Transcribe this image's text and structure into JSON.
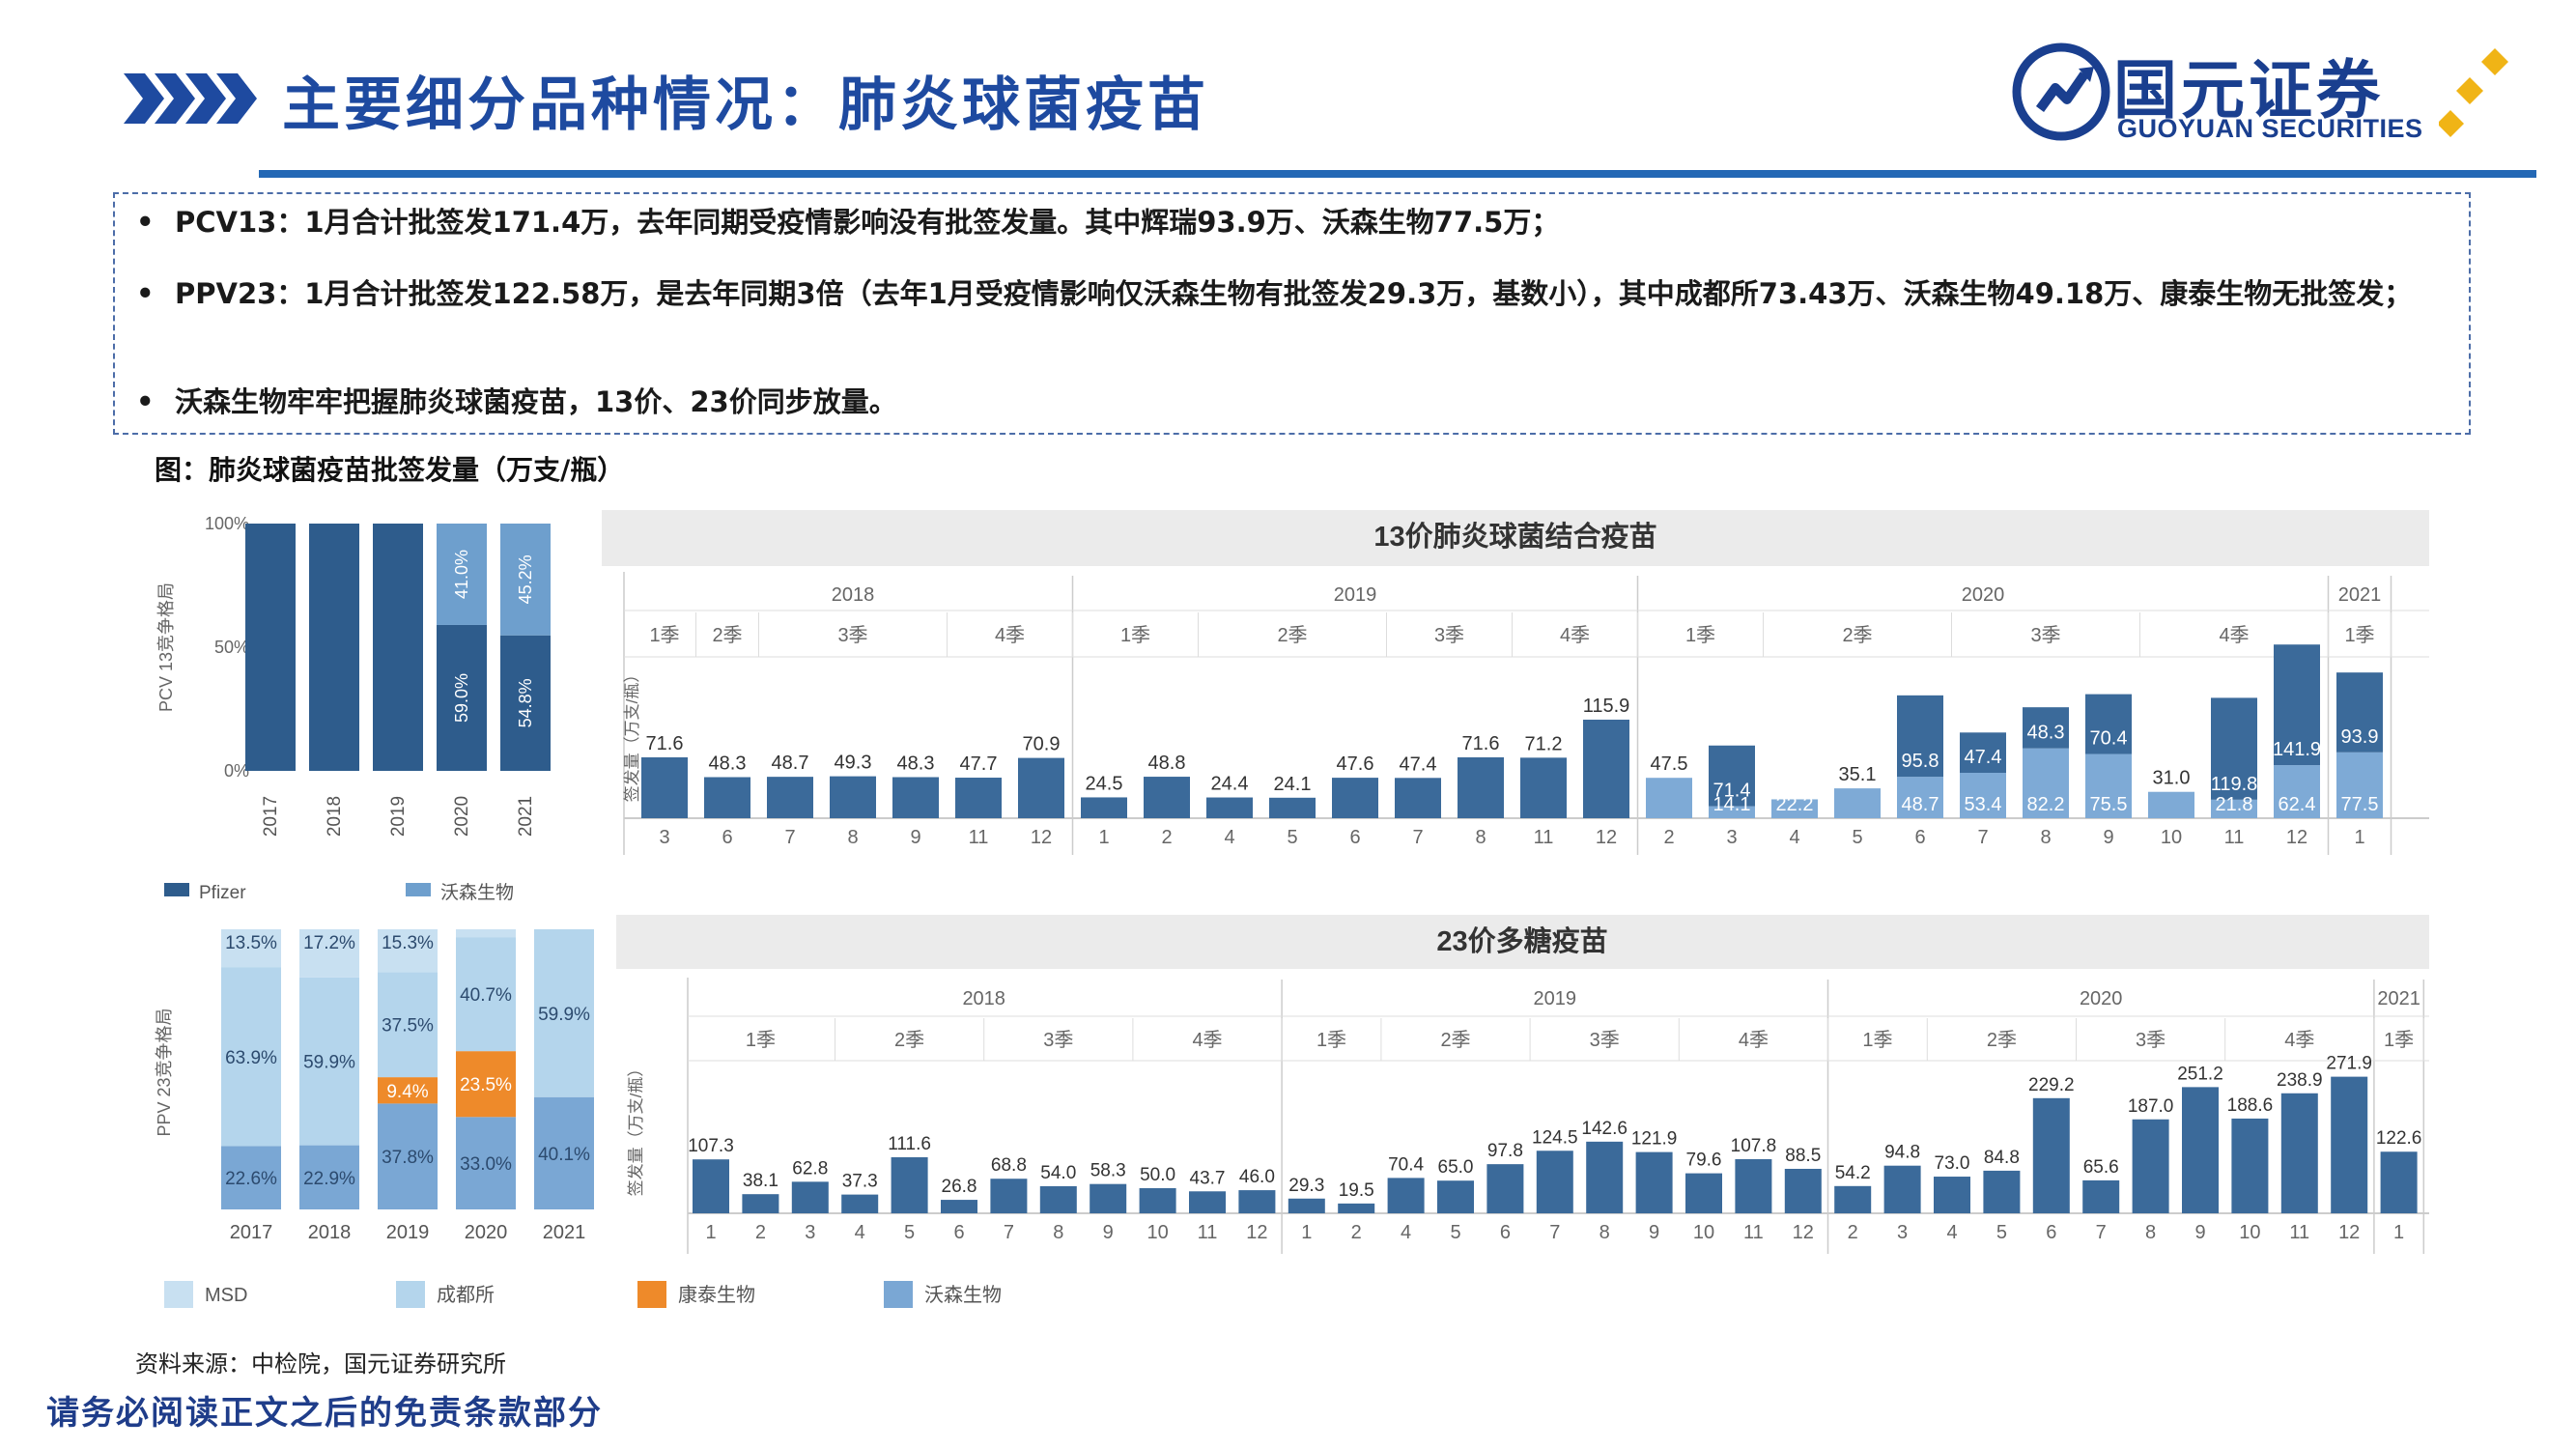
{
  "header": {
    "title": "主要细分品种情况：肺炎球菌疫苗",
    "logo_cn": "国元证券",
    "logo_en": "GUOYUAN SECURITIES",
    "accent": "#1e4aa0",
    "gold": "#f0b416"
  },
  "bullets": [
    "PCV13：1月合计批签发171.4万，去年同期受疫情影响没有批签发量。其中辉瑞93.9万、沃森生物77.5万；",
    "PPV23：1月合计批签发122.58万，是去年同期3倍（去年1月受疫情影响仅沃森生物有批签发29.3万，基数小），其中成都所73.43万、沃森生物49.18万、康泰生物无批签发；",
    "沃森生物牢牢把握肺炎球菌疫苗，13价、23价同步放量。"
  ],
  "figure_caption": "图：肺炎球菌疫苗批签发量（万支/瓶）",
  "source": "资料来源：中检院，国元证券研究所",
  "disclaimer": "请务必阅读正文之后的免责条款部分",
  "chart_data": [
    {
      "type": "bar",
      "stacked": true,
      "ylabel": "PCV 13竞争格局",
      "categories": [
        "2017",
        "2018",
        "2019",
        "2020",
        "2021"
      ],
      "ylim": [
        0,
        100
      ],
      "yticks": [
        "0%",
        "50%",
        "100%"
      ],
      "series": [
        {
          "name": "Pfizer",
          "color": "#2e5c8c",
          "values": [
            100,
            100,
            100,
            59.0,
            54.8
          ],
          "labels": [
            "",
            "",
            "",
            "59.0%",
            "54.8%"
          ]
        },
        {
          "name": "沃森生物",
          "color": "#6e9fcd",
          "values": [
            0,
            0,
            0,
            41.0,
            45.2
          ],
          "labels": [
            "",
            "",
            "",
            "41.0%",
            "45.2%"
          ]
        }
      ]
    },
    {
      "type": "bar",
      "stacked": true,
      "title": "13价肺炎球菌结合疫苗",
      "ylabel": "签发量（万支/瓶）",
      "years": [
        "2018",
        "2019",
        "2020",
        "2021"
      ],
      "quarters": [
        "1季",
        "2季",
        "3季",
        "4季",
        "1季",
        "2季",
        "3季",
        "4季",
        "1季",
        "2季",
        "3季",
        "4季",
        "1季"
      ],
      "categories": [
        "3",
        "6",
        "7",
        "8",
        "9",
        "11",
        "12",
        "1",
        "2",
        "4",
        "5",
        "6",
        "7",
        "8",
        "11",
        "12",
        "2",
        "3",
        "4",
        "5",
        "6",
        "7",
        "8",
        "9",
        "10",
        "11",
        "12",
        "1"
      ],
      "series": [
        {
          "name": "辉瑞",
          "color": "#3b6a9a",
          "values": [
            71.6,
            48.3,
            48.7,
            49.3,
            48.3,
            47.7,
            70.9,
            24.5,
            48.8,
            24.4,
            24.1,
            47.6,
            47.4,
            71.6,
            71.2,
            115.9,
            0,
            71.4,
            0,
            0,
            95.8,
            47.4,
            48.3,
            70.4,
            0,
            119.8,
            141.9,
            93.9
          ]
        },
        {
          "name": "沃森生物",
          "color": "#7eaad6",
          "values": [
            0,
            0,
            0,
            0,
            0,
            0,
            0,
            0,
            0,
            0,
            0,
            0,
            0,
            0,
            0,
            0,
            47.5,
            14.1,
            22.2,
            35.1,
            48.7,
            53.4,
            82.2,
            75.5,
            31.0,
            21.8,
            62.4,
            77.5
          ]
        }
      ]
    },
    {
      "type": "bar",
      "stacked": true,
      "ylabel": "PPV 23竞争格局",
      "categories": [
        "2017",
        "2018",
        "2019",
        "2020",
        "2021"
      ],
      "ylim": [
        0,
        100
      ],
      "series": [
        {
          "name": "沃森生物",
          "color": "#7aa7d4",
          "values": [
            22.6,
            22.9,
            37.8,
            33.0,
            40.1
          ],
          "labels": [
            "22.6%",
            "22.9%",
            "37.8%",
            "33.0%",
            "40.1%"
          ]
        },
        {
          "name": "康泰生物",
          "color": "#ee8a2a",
          "values": [
            0,
            0,
            9.4,
            23.5,
            0
          ],
          "labels": [
            "",
            "",
            "9.4%",
            "23.5%",
            ""
          ]
        },
        {
          "name": "成都所",
          "color": "#b4d5ec",
          "values": [
            63.9,
            59.9,
            37.5,
            40.7,
            59.9
          ],
          "labels": [
            "63.9%",
            "59.9%",
            "37.5%",
            "40.7%",
            "59.9%"
          ]
        },
        {
          "name": "MSD",
          "color": "#c8e0f1",
          "values": [
            13.5,
            17.2,
            15.3,
            2.8,
            0
          ],
          "labels": [
            "13.5%",
            "17.2%",
            "15.3%",
            "",
            ""
          ]
        }
      ]
    },
    {
      "type": "bar",
      "title": "23价多糖疫苗",
      "ylabel": "签发量（万支/瓶）",
      "years": [
        "2018",
        "2019",
        "2020",
        "2021"
      ],
      "quarters": [
        "1季",
        "2季",
        "3季",
        "4季",
        "1季",
        "2季",
        "3季",
        "4季",
        "1季",
        "2季",
        "3季",
        "4季",
        "1季"
      ],
      "categories": [
        "1",
        "2",
        "3",
        "4",
        "5",
        "6",
        "7",
        "8",
        "9",
        "10",
        "11",
        "12",
        "1",
        "2",
        "4",
        "5",
        "6",
        "7",
        "8",
        "9",
        "10",
        "11",
        "12",
        "2",
        "3",
        "4",
        "5",
        "6",
        "7",
        "8",
        "9",
        "10",
        "11",
        "12",
        "1"
      ],
      "series": [
        {
          "name": "批签发量",
          "color": "#3b6a9a",
          "values": [
            107.3,
            38.1,
            62.8,
            37.3,
            111.6,
            26.8,
            68.8,
            54.0,
            58.3,
            50.0,
            43.7,
            46.0,
            29.3,
            19.5,
            70.4,
            65.0,
            97.8,
            124.5,
            142.6,
            121.9,
            79.6,
            107.8,
            88.5,
            54.2,
            94.8,
            73.0,
            84.8,
            229.2,
            65.6,
            187.0,
            251.2,
            188.6,
            238.9,
            271.9,
            122.6
          ]
        }
      ]
    }
  ]
}
